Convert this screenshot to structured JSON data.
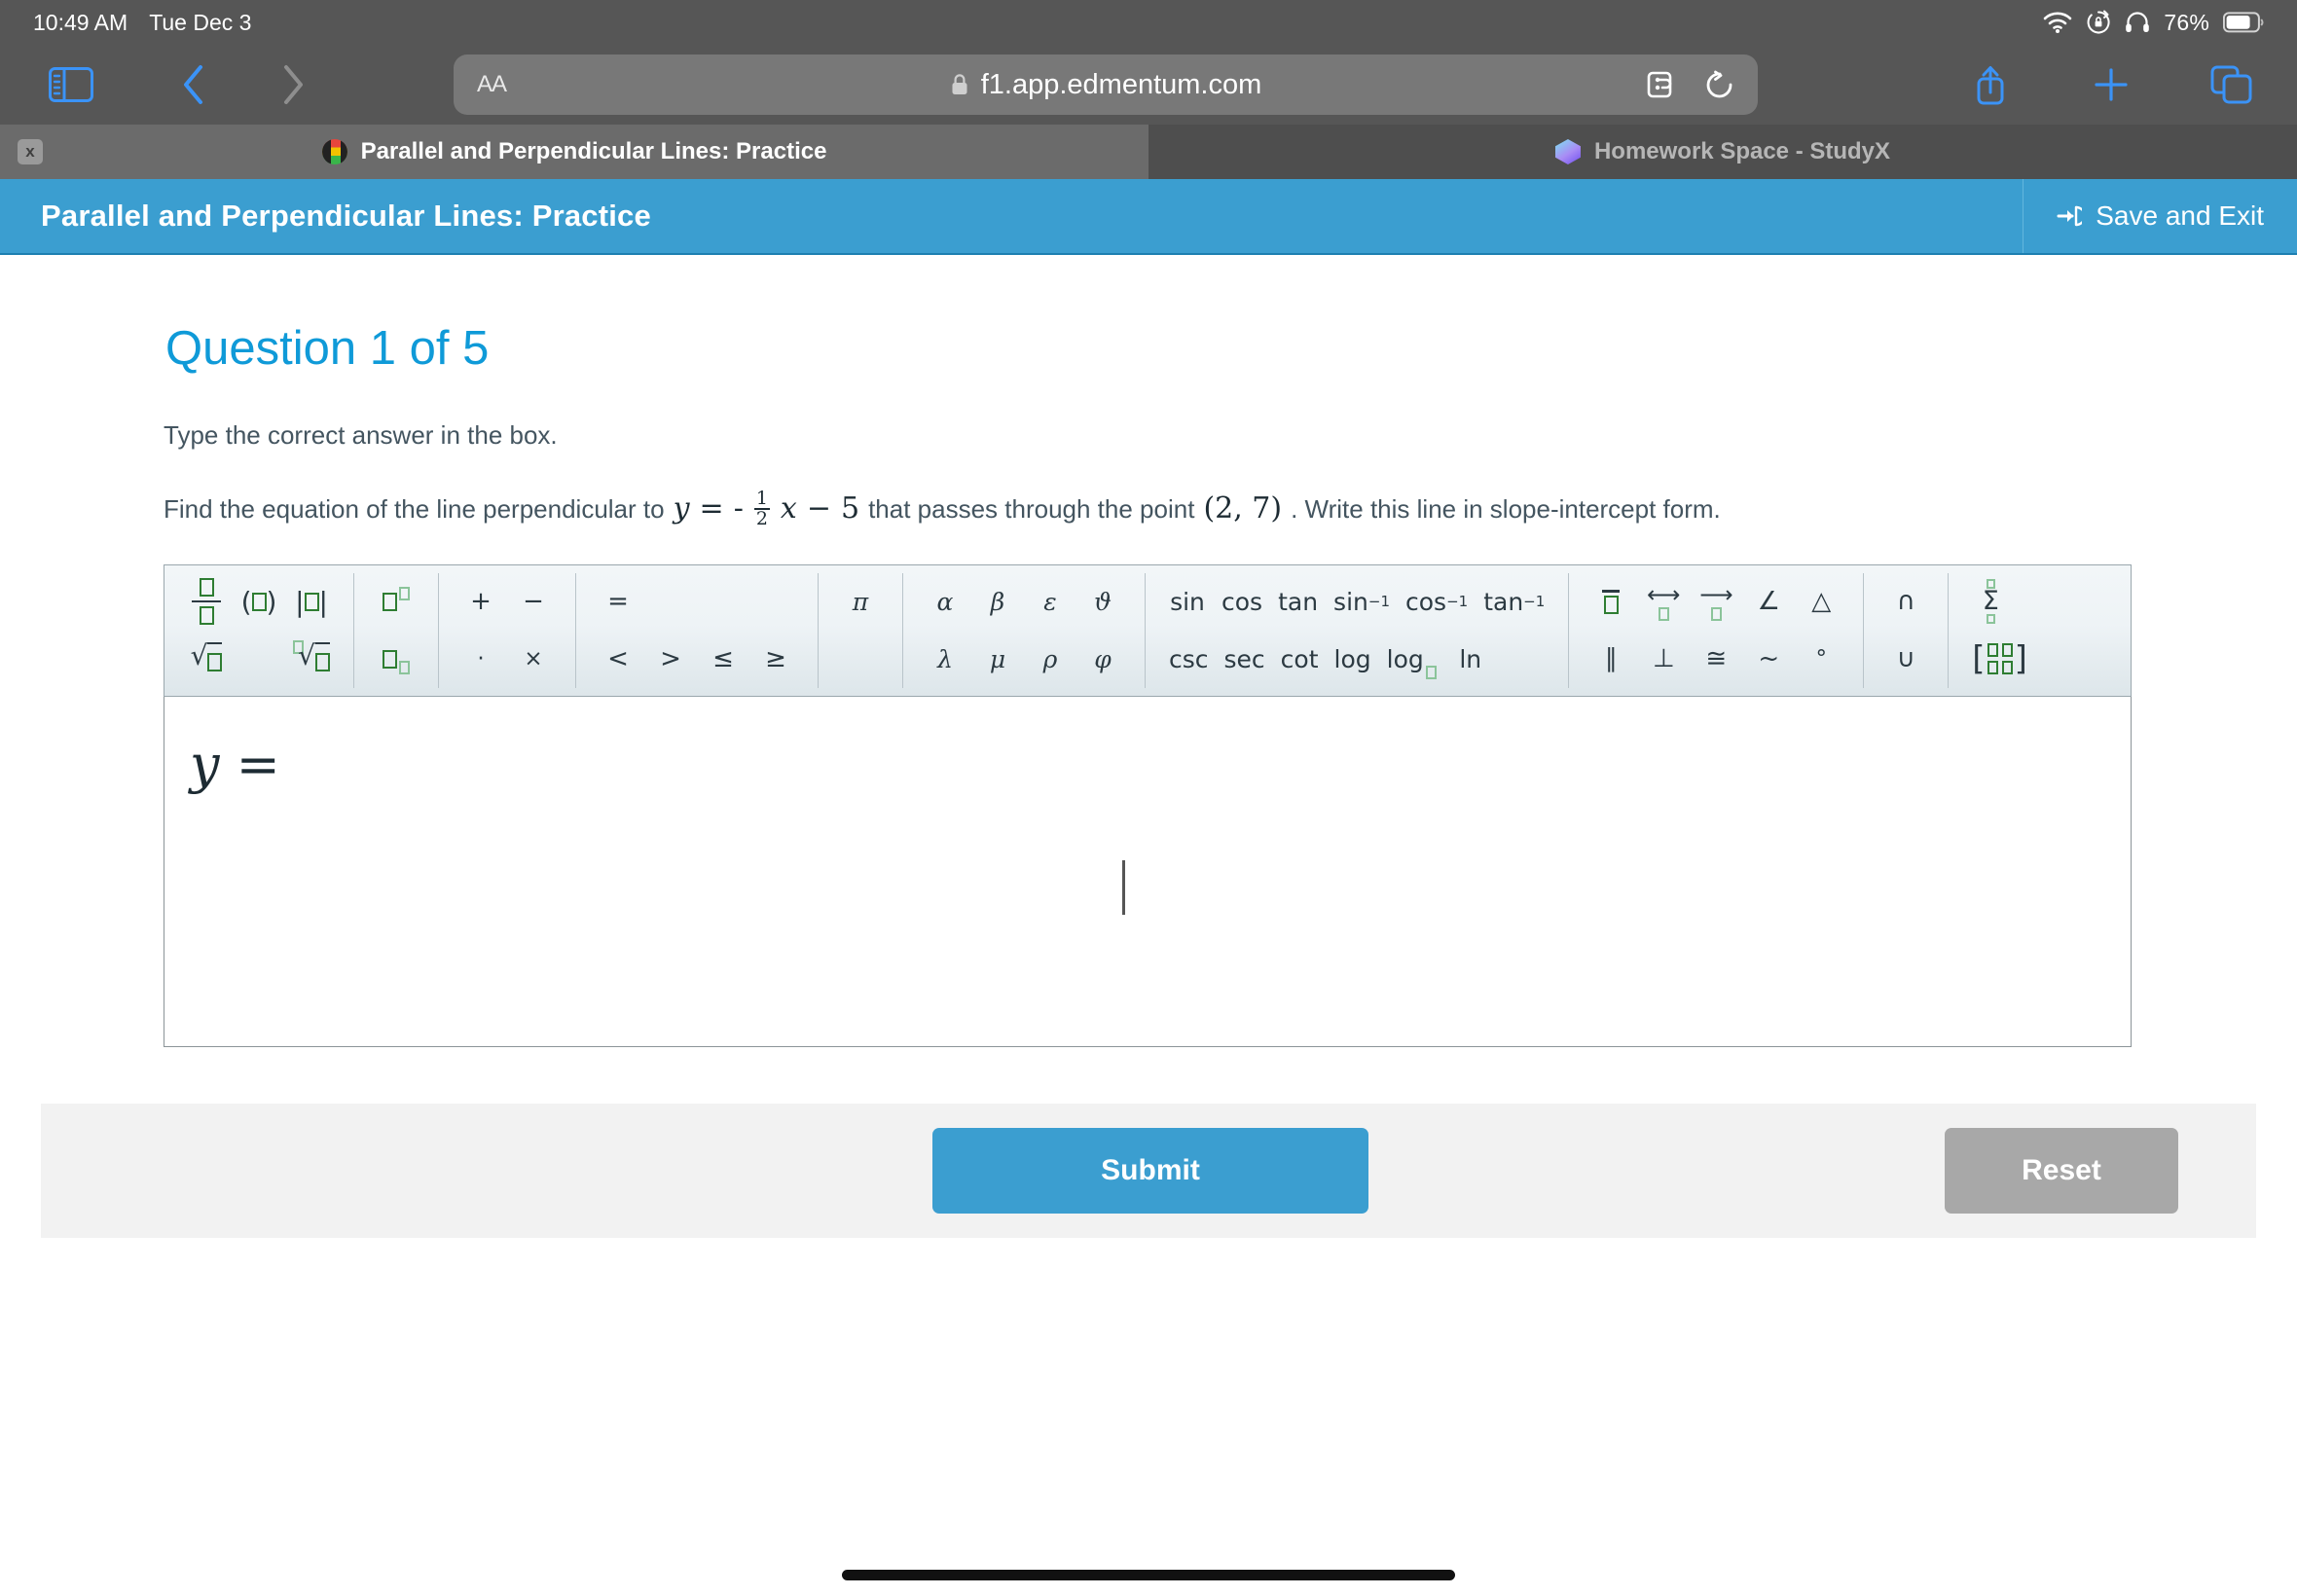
{
  "status_bar": {
    "time": "10:49 AM",
    "date": "Tue Dec 3",
    "battery_percent": "76%",
    "icons": [
      "wifi-icon",
      "rotation-lock-icon",
      "headphones-icon",
      "battery-icon"
    ]
  },
  "browser": {
    "url": "f1.app.edmentum.com",
    "lock_icon": "lock-icon",
    "text_size_label": "AA",
    "toolbar_icons": [
      "sidebar-icon",
      "back-icon",
      "forward-icon",
      "extensions-icon",
      "reload-icon",
      "share-icon",
      "new-tab-icon",
      "tabs-overview-icon"
    ],
    "tabs": [
      {
        "title": "Parallel and Perpendicular Lines: Practice",
        "favicon": "plato-icon",
        "active": true,
        "close_label": "x"
      },
      {
        "title": "Homework Space - StudyX",
        "favicon": "studyx-icon",
        "active": false
      }
    ]
  },
  "app_header": {
    "title": "Parallel and Perpendicular Lines: Practice",
    "save_exit_label": "Save and Exit",
    "save_exit_icon": "sign-out-icon",
    "accent_color": "#3b9ed0"
  },
  "question": {
    "heading": "Question 1 of 5",
    "instruction": "Type the correct answer in the box.",
    "problem_prefix": "Find the equation of the line perpendicular to",
    "equation": {
      "lhs": "y",
      "eq": "=",
      "sign": "-",
      "frac_num": "1",
      "frac_den": "2",
      "var": "x",
      "op": "−",
      "constant": "5"
    },
    "problem_middle": "that passes through the point",
    "point": "(2, 7)",
    "problem_suffix": ". Write this line in slope-intercept form.",
    "heading_color": "#0f9ad8"
  },
  "math_toolbar": {
    "groups": [
      {
        "name": "structures",
        "row1": [
          "fraction",
          "(□)",
          "|□|"
        ],
        "row2": [
          "√□",
          "",
          "ⁿ√□"
        ]
      },
      {
        "name": "scripts",
        "row1": [
          "superscript"
        ],
        "row2": [
          "subscript"
        ]
      },
      {
        "name": "operators",
        "row1": [
          "+",
          "−"
        ],
        "row2": [
          "·",
          "×"
        ]
      },
      {
        "name": "relations",
        "row1": [
          "="
        ],
        "row2": [
          "<",
          ">",
          "≤",
          "≥"
        ]
      },
      {
        "name": "constants",
        "row1": [
          "π"
        ],
        "row2": [
          ""
        ]
      },
      {
        "name": "greek",
        "row1": [
          "α",
          "β",
          "ε",
          "ϑ"
        ],
        "row2": [
          "λ",
          "μ",
          "ρ",
          "φ"
        ]
      },
      {
        "name": "trig",
        "row1": [
          "sin",
          "cos",
          "tan",
          "sin-1",
          "cos-1",
          "tan-1"
        ],
        "row2": [
          "csc",
          "sec",
          "cot",
          "log",
          "log-base",
          "ln"
        ]
      },
      {
        "name": "geometry",
        "row1": [
          "overline",
          "line",
          "ray",
          "∠",
          "△"
        ],
        "row2": [
          "∥",
          "⊥",
          "≅",
          "~",
          "°"
        ]
      },
      {
        "name": "sets",
        "row1": [
          "∩"
        ],
        "row2": [
          "∪"
        ]
      },
      {
        "name": "advanced",
        "row1": [
          "summation"
        ],
        "row2": [
          "matrix"
        ]
      }
    ]
  },
  "answer": {
    "value": "y =",
    "placeholder": ""
  },
  "footer": {
    "submit_label": "Submit",
    "reset_label": "Reset"
  }
}
